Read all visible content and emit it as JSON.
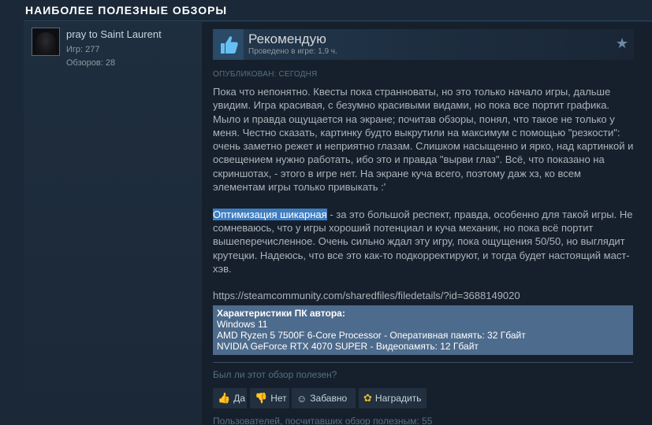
{
  "section_title": "НАИБОЛЕЕ ПОЛЕЗНЫЕ ОБЗОРЫ",
  "author": {
    "name": "pray to Saint Laurent",
    "games": "Игр: 277",
    "reviews": "Обзоров: 28"
  },
  "review": {
    "verdict": "Рекомендую",
    "playtime": "Проведено в игре: 1,9 ч.",
    "posted": "ОПУБЛИКОВАН: СЕГОДНЯ",
    "paragraph1": "Пока что непонятно. Квесты пока странноваты, но это только начало игры, дальше увидим. Игра красивая, с безумно красивыми видами, но пока все портит графика. Мыло и правда ощущается на экране; почитав обзоры, понял, что такое не только у меня. Честно сказать, картинку будто выкрутили на максимум с помощью \"резкости\": очень заметно режет и неприятно глазам. Слишком насыщенно и ярко, над картинкой и освещением нужно работать, ибо это и правда \"вырви глаз\". Всё, что показано на скриншотах, - этого в игре нет. На экране куча всего, поэтому даж хз, ко всем элементам игры только привыкать :'",
    "highlighted": "Оптимизация шикарная",
    "paragraph2_rest": " - за это большой респект, правда, особенно для такой игры. Не сомневаюсь, что у игры хороший потенциал и куча механик, но пока всё портит вышеперечисленное. Очень сильно ждал эту игру, пока ощущения 50/50, но выглядит крутецки. Надеюсь, что все это как-то подкорректируют, и тогда будет настоящий маст-хэв.",
    "link": "https://steamcommunity.com/sharedfiles/filedetails/?id=3688149020"
  },
  "specs": {
    "title": "Характеристики ПК автора:",
    "os": "Windows 11",
    "cpu": "AMD Ryzen 5 7500F 6-Core Processor - Оперативная память: 32 Гбайт",
    "gpu": "NVIDIA GeForce RTX 4070 SUPER - Видеопамять: 12 Гбайт"
  },
  "feedback": {
    "question": "Был ли этот обзор полезен?",
    "yes": "Да",
    "no": "Нет",
    "funny": "Забавно",
    "award": "Наградить",
    "helpful_count": "Пользователей, посчитавших обзор полезным: 55"
  },
  "colors": {
    "background": "#1b2838",
    "panel": "#16202d",
    "highlight": "#3f7dc1",
    "specs_bg": "#4d6b8c"
  },
  "icons": [
    "thumbs-up-icon",
    "star-icon",
    "thumbs-down-icon",
    "smile-icon",
    "award-icon"
  ]
}
